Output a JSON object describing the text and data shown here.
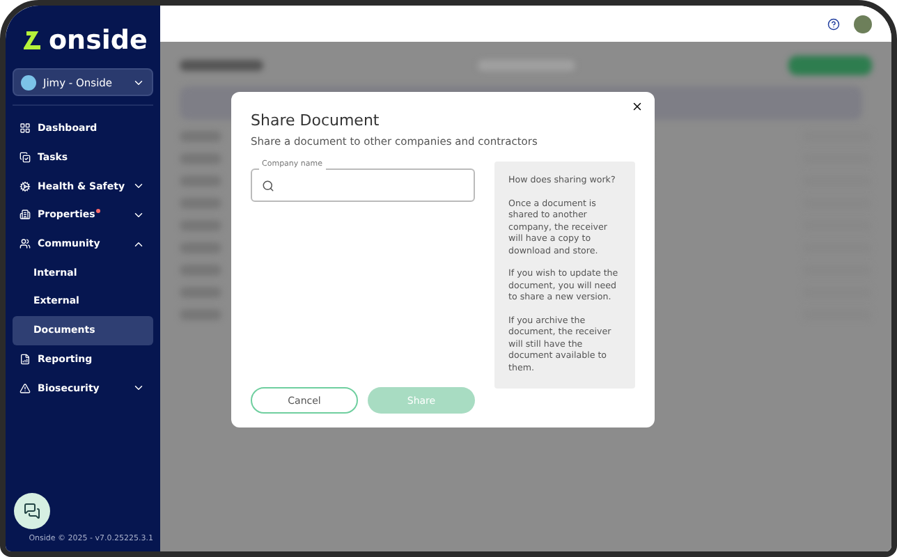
{
  "sidebar": {
    "brand": "onside",
    "user": "Jimy - Onside",
    "items": [
      {
        "label": "Dashboard",
        "expandable": false,
        "expanded": false,
        "badge": false,
        "selected": false
      },
      {
        "label": "Tasks",
        "expandable": false,
        "expanded": false,
        "badge": false,
        "selected": false
      },
      {
        "label": "Health & Safety",
        "expandable": true,
        "expanded": false,
        "badge": false,
        "selected": false
      },
      {
        "label": "Properties",
        "expandable": true,
        "expanded": false,
        "badge": true,
        "selected": false
      },
      {
        "label": "Community",
        "expandable": true,
        "expanded": true,
        "badge": false,
        "selected": false,
        "children": [
          {
            "label": "Internal",
            "selected": false
          },
          {
            "label": "External",
            "selected": false
          },
          {
            "label": "Documents",
            "selected": true
          }
        ]
      },
      {
        "label": "Reporting",
        "expandable": false,
        "expanded": false,
        "badge": false,
        "selected": false
      },
      {
        "label": "Biosecurity",
        "expandable": true,
        "expanded": false,
        "badge": false,
        "selected": false
      }
    ],
    "footer": "Onside © 2025 - v7.0.25225.3.1"
  },
  "modal": {
    "title": "Share Document",
    "subtitle": "Share a document to other companies and contractors",
    "field": {
      "label": "Company name"
    },
    "info": {
      "title": "How does sharing work?",
      "paragraphs": [
        "Once a document is shared to another company, the receiver will have a copy to download and store.",
        "If you wish to update the document, you will need to share a new version.",
        "If you archive the document, the receiver will still have the document available to them."
      ]
    },
    "buttons": [
      {
        "label": "Cancel",
        "disabled": false
      },
      {
        "label": "Share",
        "disabled": true
      }
    ]
  }
}
